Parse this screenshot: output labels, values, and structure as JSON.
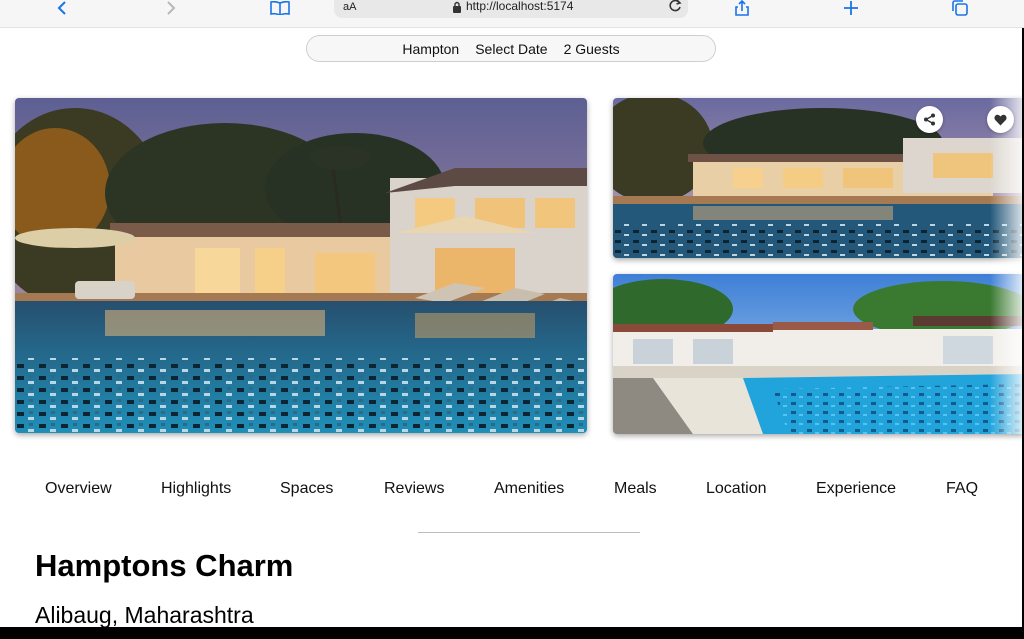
{
  "browser": {
    "text_size_label": "aA",
    "url": "http://localhost:5174",
    "icons": [
      "back-icon",
      "forward-icon",
      "bookmarks-icon",
      "lock-icon",
      "reload-icon",
      "share-icon",
      "new-tab-icon",
      "tabs-icon"
    ]
  },
  "search": {
    "location": "Hampton",
    "date": "Select Date",
    "guests": "2 Guests"
  },
  "gallery": {
    "actions": [
      "share-icon",
      "heart-icon"
    ]
  },
  "nav": {
    "items": [
      "Overview",
      "Highlights",
      "Spaces",
      "Reviews",
      "Amenities",
      "Meals",
      "Location",
      "Experience",
      "FAQ"
    ]
  },
  "property": {
    "name": "Hamptons Charm",
    "location": "Alibaug, Maharashtra"
  },
  "colors": {
    "accent": "#1a73e8",
    "pool": "#2aa7d8",
    "dusk_sky": "#6e6a9a"
  }
}
